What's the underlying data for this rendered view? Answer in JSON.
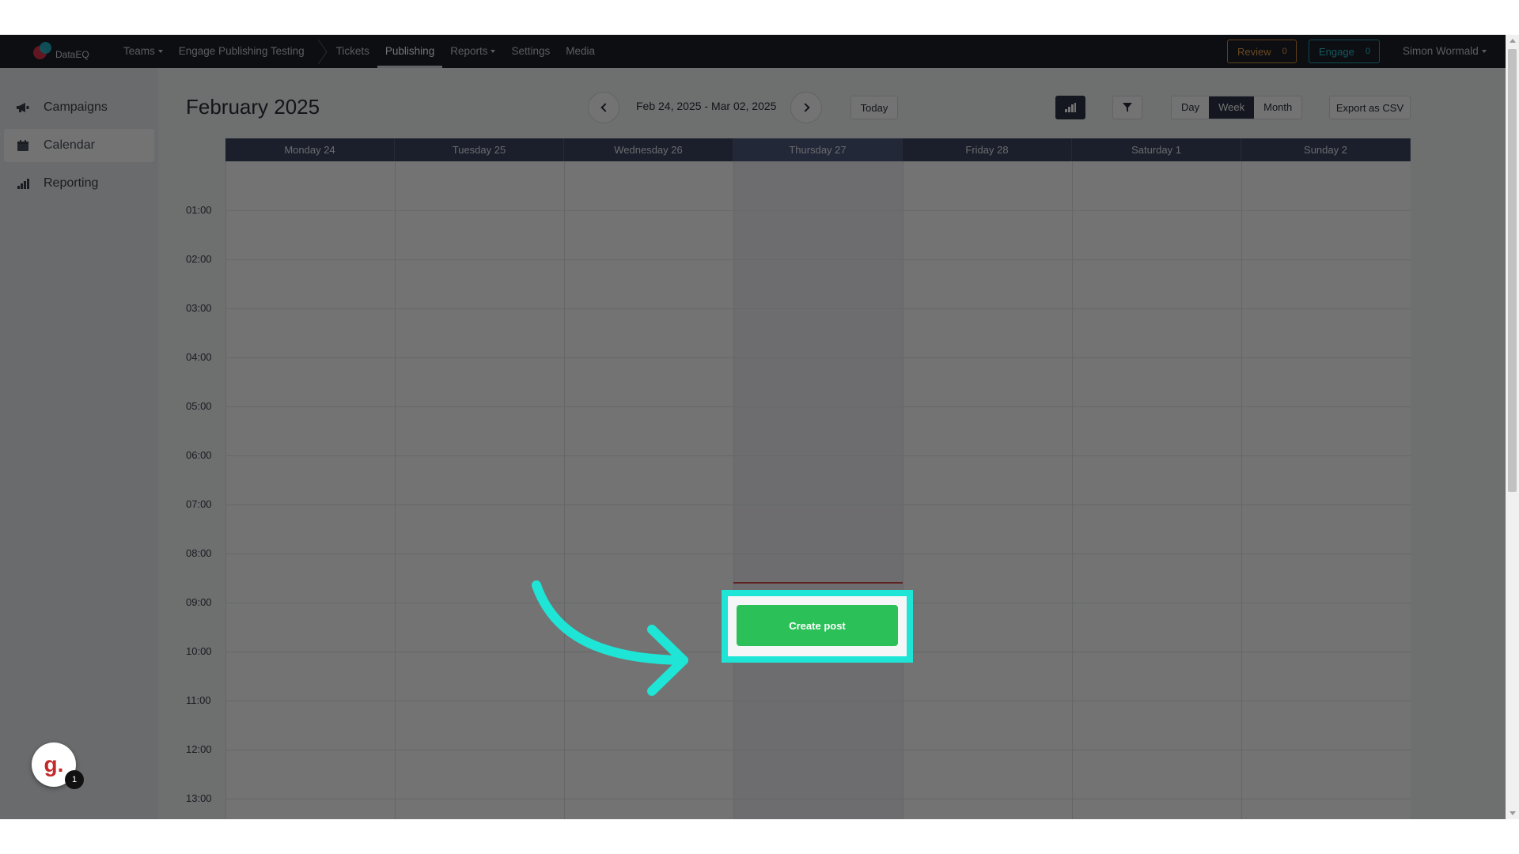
{
  "brand": {
    "name": "DataEQ"
  },
  "nav": {
    "teams": "Teams",
    "team_name": "Engage Publishing Testing",
    "tickets": "Tickets",
    "publishing": "Publishing",
    "reports": "Reports",
    "settings": "Settings",
    "media": "Media"
  },
  "pills": {
    "review_label": "Review",
    "review_count": "0",
    "engage_label": "Engage",
    "engage_count": "0"
  },
  "user": {
    "name": "Simon Wormald"
  },
  "sidebar": {
    "items": [
      {
        "label": "Campaigns",
        "icon": "megaphone-icon"
      },
      {
        "label": "Calendar",
        "icon": "calendar-icon",
        "active": true
      },
      {
        "label": "Reporting",
        "icon": "bar-chart-icon"
      }
    ]
  },
  "calendar": {
    "title": "February 2025",
    "range": "Feb 24, 2025 - Mar 02, 2025",
    "today_button": "Today",
    "view_options": [
      "Day",
      "Week",
      "Month"
    ],
    "active_view": "Week",
    "export_label": "Export as CSV",
    "days": [
      "Monday 24",
      "Tuesday 25",
      "Wednesday 26",
      "Thursday 27",
      "Friday 28",
      "Saturday 1",
      "Sunday 2"
    ],
    "today_index": 3,
    "hours": [
      "01:00",
      "02:00",
      "03:00",
      "04:00",
      "05:00",
      "06:00",
      "07:00",
      "08:00",
      "09:00",
      "10:00",
      "11:00",
      "12:00",
      "13:00"
    ]
  },
  "action": {
    "create_post": "Create post"
  },
  "widget": {
    "letter": "g.",
    "badge": "1"
  },
  "colors": {
    "highlight": "#1ee5d6",
    "create_button": "#2cc158",
    "nav_bg": "#1b1f29",
    "review": "#e8a04a",
    "engage": "#2ec2cf"
  }
}
